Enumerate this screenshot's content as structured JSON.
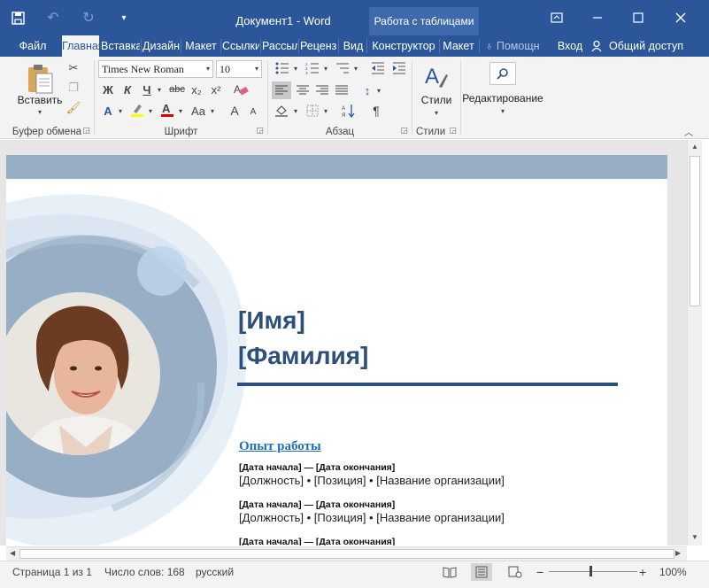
{
  "titlebar": {
    "document_title": "Документ1 - Word",
    "context_tab": "Работа с таблицами",
    "qat": {
      "save_icon": "save-icon",
      "undo_icon": "undo-icon",
      "redo_icon": "redo-icon",
      "customize_icon": "qat-customize-icon"
    },
    "window": {
      "ribbon_display_icon": "ribbon-display-options-icon",
      "minimize_icon": "minimize-icon",
      "maximize_icon": "maximize-icon",
      "close_icon": "close-icon"
    }
  },
  "tabs": [
    {
      "label": "Файл"
    },
    {
      "label": "Главная",
      "active": true
    },
    {
      "label": "Вставка"
    },
    {
      "label": "Дизайн"
    },
    {
      "label": "Макет"
    },
    {
      "label": "Ссылки"
    },
    {
      "label": "Рассылки"
    },
    {
      "label": "Рецензирование"
    },
    {
      "label": "Вид"
    },
    {
      "label": "Конструктор"
    },
    {
      "label": "Макет"
    }
  ],
  "tell_me": "Помощн",
  "signin": "Вход",
  "share": "Общий доступ",
  "ribbon": {
    "clipboard": {
      "label": "Буфер обмена",
      "paste_label": "Вставить"
    },
    "font": {
      "label": "Шрифт",
      "font_name": "Times New Roman",
      "font_size": "10",
      "bold": "Ж",
      "italic": "К",
      "underline": "Ч",
      "strike": "abc",
      "subscript": "x₂",
      "superscript": "x²",
      "case": "Aa",
      "grow": "A",
      "shrink": "A"
    },
    "paragraph": {
      "label": "Абзац",
      "pilcrow": "¶"
    },
    "styles": {
      "label": "Стили",
      "button_label": "Стили"
    },
    "editing": {
      "button_label": "Редактирование"
    }
  },
  "document": {
    "first_name": "[Имя]",
    "last_name": "[Фамилия]",
    "section_title": "Опыт работы",
    "entries": [
      {
        "dates": "[Дата начала] — [Дата окончания]",
        "line": "[Должность] • [Позиция] • [Название организации]"
      },
      {
        "dates": "[Дата начала] — [Дата окончания]",
        "line": "[Должность] • [Позиция] • [Название организации]"
      },
      {
        "dates": "[Дата начала] — [Дата окончания]",
        "line": ""
      }
    ]
  },
  "statusbar": {
    "page": "Страница 1 из 1",
    "words": "Число слов: 168",
    "language": "русский",
    "zoom": "100%",
    "zoom_minus": "−",
    "zoom_plus": "+"
  },
  "colors": {
    "word_blue": "#2b579a",
    "heading_blue": "#2c5079",
    "link_blue": "#1f6fb6",
    "band": "#97aec5"
  }
}
